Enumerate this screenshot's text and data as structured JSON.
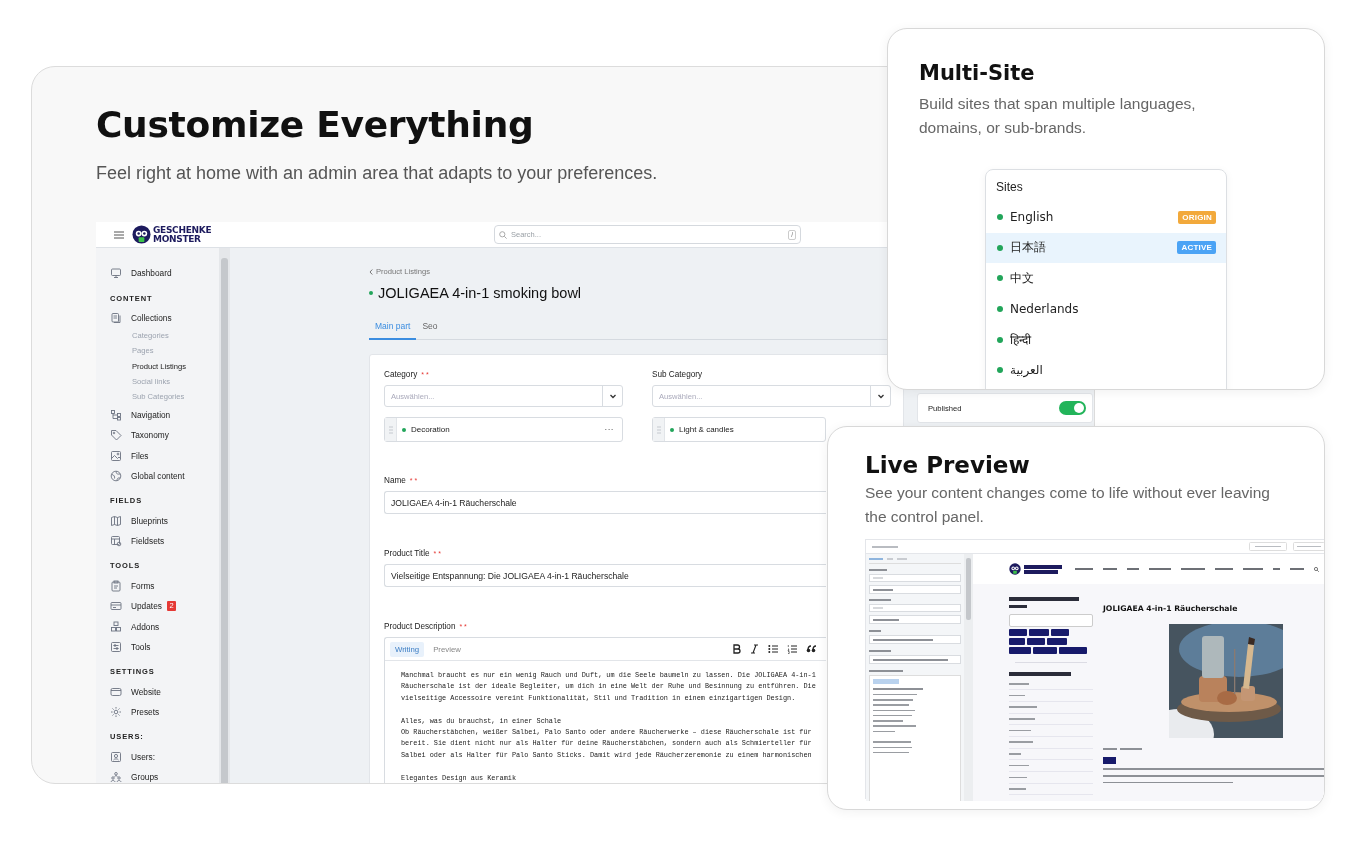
{
  "hero": {
    "title": "Customize Everything",
    "subtitle": "Feel right at home with an admin area that adapts to your preferences."
  },
  "admin": {
    "logo": [
      "GESCHENKE",
      "MONSTER"
    ],
    "search": {
      "placeholder": "Search...",
      "shortcut": "/"
    },
    "sidebar": [
      {
        "items": [
          {
            "label": "Dashboard",
            "selected": false
          }
        ]
      },
      {
        "heading": "CONTENT",
        "items": [
          {
            "label": "Collections",
            "selected": false,
            "children": [
              {
                "label": "Categories",
                "selected": false
              },
              {
                "label": "Pages",
                "selected": false
              },
              {
                "label": "Product Listings",
                "selected": true
              },
              {
                "label": "Social links",
                "selected": false
              },
              {
                "label": "Sub Categories",
                "selected": false
              }
            ]
          },
          {
            "label": "Navigation",
            "selected": false
          },
          {
            "label": "Taxonomy",
            "selected": false
          },
          {
            "label": "Files",
            "selected": false
          },
          {
            "label": "Global content",
            "selected": false
          }
        ]
      },
      {
        "heading": "FIELDS",
        "items": [
          {
            "label": "Blueprints",
            "selected": false
          },
          {
            "label": "Fieldsets",
            "selected": false
          }
        ]
      },
      {
        "heading": "TOOLS",
        "items": [
          {
            "label": "Forms",
            "selected": false
          },
          {
            "label": "Updates",
            "selected": false,
            "badge": "2"
          },
          {
            "label": "Addons",
            "selected": false
          },
          {
            "label": "Tools",
            "selected": false
          }
        ]
      },
      {
        "heading": "SETTINGS",
        "items": [
          {
            "label": "Website",
            "selected": false
          },
          {
            "label": "Presets",
            "selected": false
          }
        ]
      },
      {
        "heading": "USERS:",
        "items": [
          {
            "label": "Users:",
            "selected": false
          },
          {
            "label": "Groups",
            "selected": false
          }
        ]
      }
    ],
    "breadcrumb": "Product Listings",
    "title": "JOLIGAEA 4-in-1 smoking bowl",
    "published": true,
    "tabs": [
      {
        "label": "Main part",
        "selected": true
      },
      {
        "label": "Seo",
        "selected": false
      }
    ],
    "fields": [
      {
        "kind": "select",
        "label": "Category",
        "mark": "* *",
        "placeholder": "Auswählen...",
        "chosen": {
          "label": "Decoration",
          "published": true,
          "more": "···"
        }
      },
      {
        "kind": "select",
        "label": "Sub Category",
        "placeholder": "Auswählen...",
        "chosen": {
          "label": "Light & candles",
          "published": true
        }
      },
      {
        "kind": "text",
        "label": "Name",
        "mark": "* *",
        "value": "JOLIGAEA 4-in-1 Räucherschale"
      },
      {
        "kind": "text",
        "label": "Product Title",
        "mark": "* *",
        "value": "Vielseitige Entspannung: Die JOLIGAEA 4-in-1 Räucherschale"
      },
      {
        "kind": "markdown",
        "label": "Product Description",
        "mark": "* *",
        "tabs": [
          {
            "label": "Writing",
            "selected": true
          },
          {
            "label": "Preview",
            "selected": false
          }
        ],
        "paragraphs": [
          [
            "Manchmal braucht es nur ein wenig Rauch und Duft, um die Seele baumeln zu lassen. Die JOLIGAEA 4-in-1",
            "Räucherschale ist der ideale Begleiter, um dich in eine Welt der Ruhe und Besinnung zu entführen. Die",
            "vielseitige Accessoire vereint Funktionalität, Stil und Tradition in einem einzigartigen Design."
          ],
          [
            "Alles, was du brauchst, in einer Schale",
            "Ob Räucherstäbchen, weißer Salbei, Palo Santo oder andere Räucherwerke – diese Räucherschale ist für",
            "bereit. Sie dient nicht nur als Halter für deine Räucherstäbchen, sondern auch als Schmierteller für",
            "Salbei oder als Halter für Palo Santo Sticks. Damit wird jede Räucherzeremonie zu einem harmonischen"
          ],
          [
            "Elegantes Design aus Keramik"
          ]
        ]
      }
    ],
    "status": {
      "label": "Published",
      "on": true
    }
  },
  "multisite": {
    "title": "Multi-Site",
    "description": "Build sites that span multiple languages, domains, or sub-brands.",
    "heading": "Sites",
    "sites": [
      {
        "name": "English",
        "published": true,
        "selected": false,
        "badge": {
          "text": "ORIGIN",
          "color": "#f2a93b"
        }
      },
      {
        "name": "日本語",
        "published": true,
        "selected": true,
        "badge": {
          "text": "ACTIVE",
          "color": "#4ba3f5"
        }
      },
      {
        "name": "中文",
        "published": true,
        "selected": false
      },
      {
        "name": "Nederlands",
        "published": true,
        "selected": false
      },
      {
        "name": "हिन्दी",
        "published": true,
        "selected": false
      },
      {
        "name": "العربية",
        "published": true,
        "selected": false
      }
    ]
  },
  "preview": {
    "title": "Live Preview",
    "description": "See your content changes come to life without ever leaving the control panel.",
    "article": {
      "title": "JOLIGAEA 4-in-1 Räucherschale"
    }
  }
}
